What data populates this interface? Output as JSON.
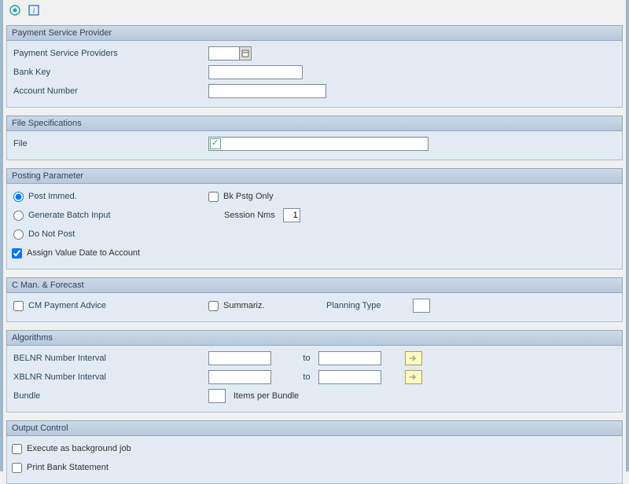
{
  "groups": {
    "psp": {
      "title": "Payment Service Provider",
      "fields": {
        "providers_label": "Payment Service Providers",
        "providers_value": "",
        "bankkey_label": "Bank Key",
        "bankkey_value": "",
        "acct_label": "Account Number",
        "acct_value": ""
      }
    },
    "filespec": {
      "title": "File Specifications",
      "file_label": "File",
      "file_value": ""
    },
    "posting": {
      "title": "Posting Parameter",
      "post_immed": "Post Immed.",
      "gen_batch": "Generate Batch Input",
      "do_not_post": "Do Not Post",
      "assign_value_date": "Assign Value Date to Account",
      "bk_pstg_only": "Bk Pstg Only",
      "session_nms_label": "Session Nms",
      "session_nms_value": "1"
    },
    "cman": {
      "title": "C Man. & Forecast",
      "cm_payment_advice": "CM Payment Advice",
      "summariz": "Summariz.",
      "planning_type_label": "Planning Type",
      "planning_type_value": ""
    },
    "algo": {
      "title": "Algorithms",
      "belnr_label": "BELNR Number Interval",
      "xblnr_label": "XBLNR Number Interval",
      "to": "to",
      "bundle_label": "Bundle",
      "items_per_bundle": "Items per Bundle",
      "bundle_value": "",
      "belnr_from": "",
      "belnr_to": "",
      "xblnr_from": "",
      "xblnr_to": ""
    },
    "output": {
      "title": "Output Control",
      "exec_bg": "Execute as background job",
      "print_bank": "Print Bank Statement"
    }
  }
}
